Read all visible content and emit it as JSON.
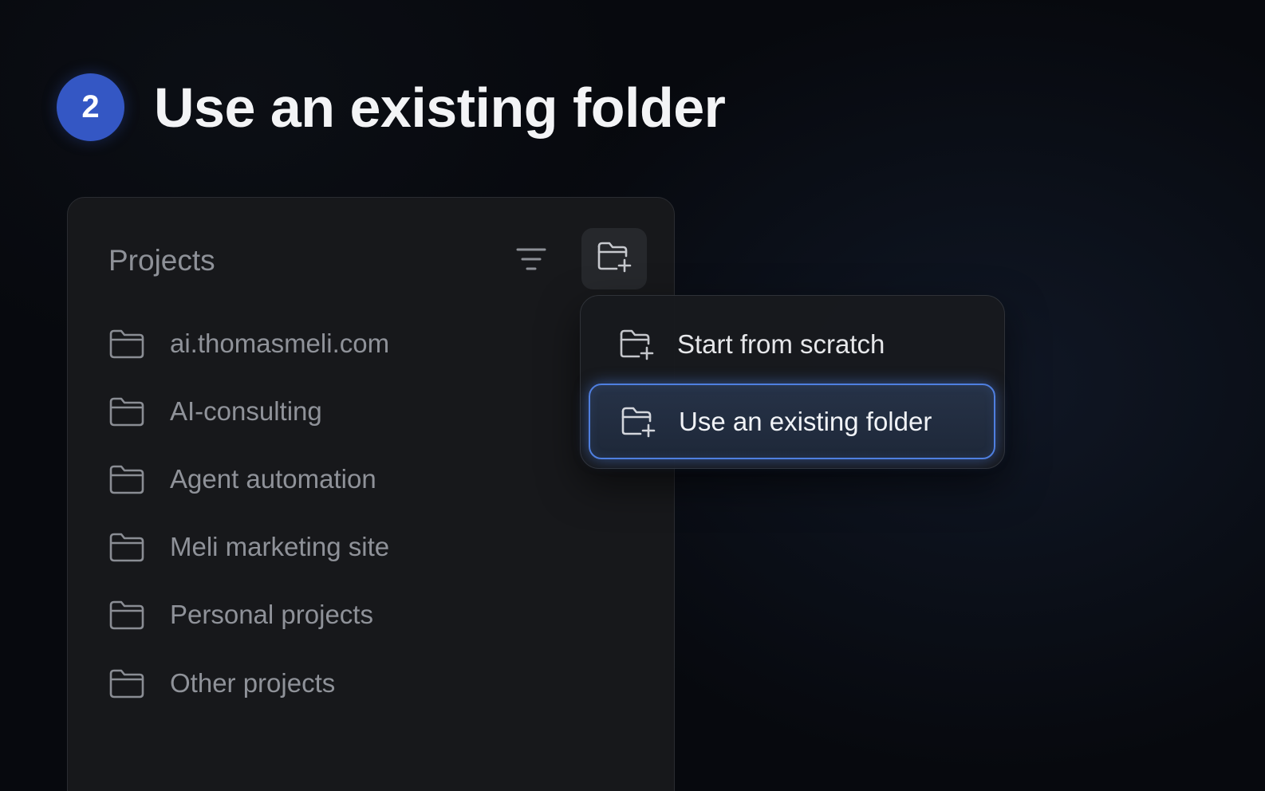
{
  "step": {
    "number": "2",
    "title": "Use an existing folder"
  },
  "panel": {
    "title": "Projects",
    "projects": [
      {
        "label": "ai.thomasmeli.com"
      },
      {
        "label": "AI-consulting"
      },
      {
        "label": "Agent automation"
      },
      {
        "label": "Meli marketing site"
      },
      {
        "label": "Personal projects"
      },
      {
        "label": "Other projects"
      }
    ]
  },
  "menu": {
    "items": [
      {
        "label": "Start from scratch",
        "icon": "folder-plus-icon",
        "highlighted": false
      },
      {
        "label": "Use an existing folder",
        "icon": "folder-plus-icon",
        "highlighted": true
      }
    ]
  },
  "icons": {
    "filter": "filter-icon",
    "new_project": "folder-plus-icon",
    "project": "folder-icon"
  },
  "colors": {
    "badge": "#3457c4",
    "highlight_border": "#4f7fe0",
    "background": "#07090e",
    "panel": "#17181b"
  }
}
